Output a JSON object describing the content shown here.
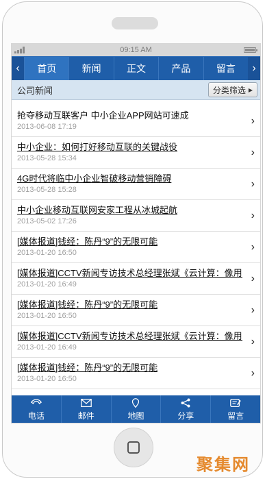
{
  "statusbar": {
    "time": "09:15 AM"
  },
  "nav": {
    "tabs": [
      {
        "label": "首页"
      },
      {
        "label": "新闻"
      },
      {
        "label": "正文"
      },
      {
        "label": "产品"
      },
      {
        "label": "留言"
      }
    ]
  },
  "subbar": {
    "title": "公司新闻",
    "filter_label": "分类筛选"
  },
  "news": [
    {
      "title": "抢夺移动互联客户 中小企业APP网站可速成",
      "date": "2013-06-08 17:19"
    },
    {
      "title": "中小企业：如何打好移动互联的关键战役",
      "date": "2013-05-28 15:34"
    },
    {
      "title": "4G时代将临中小企业智破移动营销障碍",
      "date": "2013-05-28 15:28"
    },
    {
      "title": "中小企业移动互联网安家工程从冰城起航",
      "date": "2013-05-02 17:26"
    },
    {
      "title": "[媒体报道]钱经：陈丹“9”的无限可能",
      "date": "2013-01-20 16:50"
    },
    {
      "title": "[媒体报道]CCTV新闻专访技术总经理张斌《云计算：像用电",
      "date": "2013-01-20 16:49"
    },
    {
      "title": "[媒体报道]钱经：陈丹“9”的无限可能",
      "date": "2013-01-20 16:50"
    },
    {
      "title": "[媒体报道]CCTV新闻专访技术总经理张斌《云计算：像用电",
      "date": "2013-01-20 16:49"
    },
    {
      "title": "[媒体报道]钱经：陈丹“9”的无限可能",
      "date": "2013-01-20 16:50"
    }
  ],
  "bottom_nav": [
    {
      "label": "电话",
      "icon": "phone-icon"
    },
    {
      "label": "邮件",
      "icon": "mail-icon"
    },
    {
      "label": "地图",
      "icon": "map-pin-icon"
    },
    {
      "label": "分享",
      "icon": "share-icon"
    },
    {
      "label": "留言",
      "icon": "message-icon"
    }
  ],
  "watermark": "聚集网",
  "colors": {
    "primary": "#1f5ea9",
    "subbar_bg": "#d6e4f1",
    "date": "#a0a0a0"
  }
}
